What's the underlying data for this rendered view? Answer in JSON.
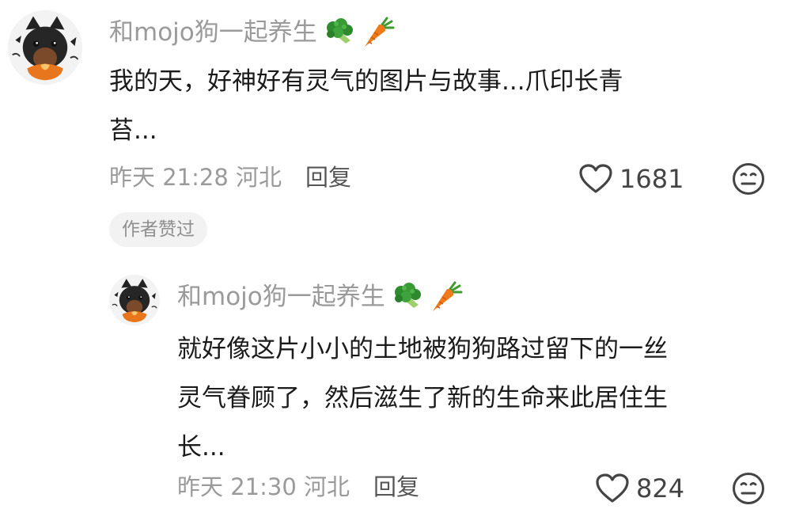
{
  "comments": [
    {
      "username": "和mojo狗一起养生",
      "username_emojis": [
        "broccoli-icon",
        "carrot-icon"
      ],
      "text_lines": [
        "我的天，好神好有灵气的图片与故事...爪印长青",
        "苔..."
      ],
      "meta": "昨天 21:28 河北",
      "reply_label": "回复",
      "like_count": "1681",
      "author_liked_label": "作者赞过"
    },
    {
      "username": "和mojo狗一起养生",
      "username_emojis": [
        "broccoli-icon",
        "carrot-icon"
      ],
      "text_lines": [
        "就好像这片小小的土地被狗狗路过留下的一丝",
        "灵气眷顾了，然后滋生了新的生命来此居住生",
        "长..."
      ],
      "meta": "昨天 21:30 河北",
      "reply_label": "回复",
      "like_count": "824"
    }
  ],
  "colors": {
    "username": "#9a9a9a",
    "text": "#1b1b1b",
    "meta": "#9a9a9a",
    "tag_bg": "#f2f2f2"
  }
}
